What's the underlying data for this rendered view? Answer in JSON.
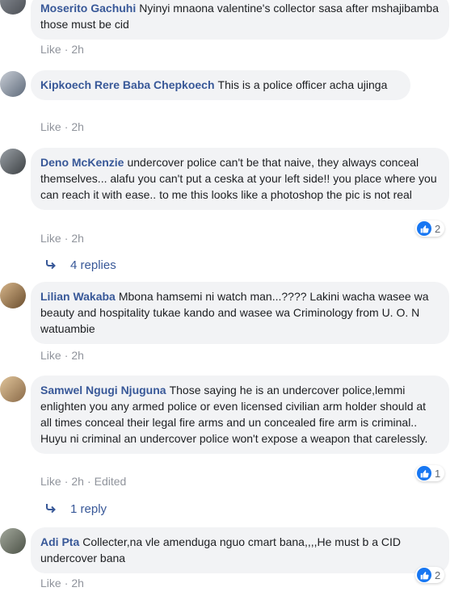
{
  "comments": [
    {
      "author": "Moserito Gachuhi",
      "text": "Nyinyi mnaona valentine's collector sasa after mshajibamba those must be cid",
      "like": "Like",
      "time": "2h"
    },
    {
      "author": "Kipkoech Rere Baba Chepkoech",
      "text": "This is a police officer acha ujinga",
      "like": "Like",
      "time": "2h"
    },
    {
      "author": "Deno McKenzie",
      "text": "undercover police can't be that naive, they always conceal themselves... alafu you can't put a ceska at your left side!! you place where you can reach it with ease.. to me this looks like a photoshop the pic is not real",
      "like": "Like",
      "time": "2h",
      "reactions": "2",
      "replies": "4 replies"
    },
    {
      "author": "Lilian Wakaba",
      "text": "Mbona hamsemi ni watch man...???? Lakini wacha wasee wa beauty and hospitality tukae kando and wasee wa Criminology from U. O. N watuambie",
      "like": "Like",
      "time": "2h"
    },
    {
      "author": "Samwel Ngugi Njuguna",
      "text": "Those saying he is an undercover police,lemmi enlighten you any armed police or even licensed civilian arm holder should at all times conceal their legal fire arms and un concealed fire arm is criminal.. Huyu ni criminal an undercover police won't expose a weapon that carelessly.",
      "like": "Like",
      "time": "2h",
      "edited": "Edited",
      "reactions": "1",
      "replies": "1 reply"
    },
    {
      "author": "Adi Pta",
      "text": "Collecter,na vle amenduga nguo cmart bana,,,,He must b a CID undercover bana",
      "like": "Like",
      "time": "2h",
      "reactions": "2"
    }
  ],
  "colors": {
    "author": "#385898",
    "bubble": "#f2f3f5",
    "meta": "#90949c",
    "like_badge": "#1877f2"
  },
  "icons": {
    "reaction": "thumbs-up-icon",
    "reply": "reply-arrow-icon"
  }
}
